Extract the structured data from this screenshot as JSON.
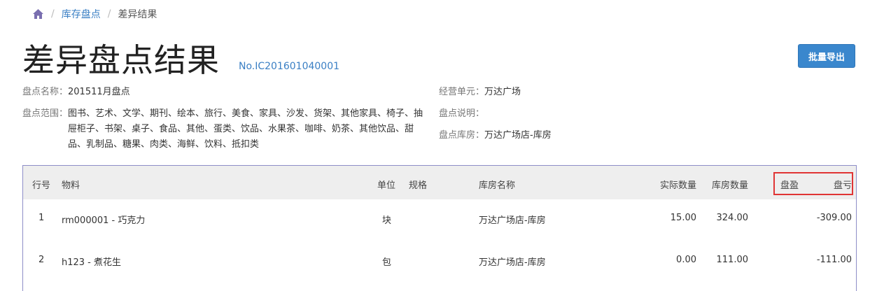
{
  "breadcrumb": {
    "home_icon": "home-icon",
    "separator": "/",
    "link": "库存盘点",
    "current": "差异结果"
  },
  "header": {
    "title": "差异盘点结果",
    "doc_no": "No.IC201601040001",
    "export_label": "批量导出"
  },
  "meta": {
    "name_label": "盘点名称：",
    "name_value": "201511月盘点",
    "range_label": "盘点范围：",
    "range_value": "图书、艺术、文学、期刊、绘本、旅行、美食、家具、沙发、货架、其他家具、椅子、抽屉柜子、书架、桌子、食品、其他、蛋类、饮品、水果茶、咖啡、奶茶、其他饮品、甜品、乳制品、糖果、肉类、海鲜、饮料、抵扣类",
    "unit_label": "经营单元：",
    "unit_value": "万达广场",
    "desc_label": "盘点说明：",
    "desc_value": "",
    "warehouse_label": "盘点库房：",
    "warehouse_value": "万达广场店-库房"
  },
  "table": {
    "headers": {
      "row_no": "行号",
      "material": "物料",
      "unit": "单位",
      "spec": "规格",
      "warehouse": "库房名称",
      "actual_qty": "实际数量",
      "stock_qty": "库房数量",
      "surplus": "盘盈",
      "loss": "盘亏"
    },
    "rows": [
      {
        "row_no": "1",
        "material": "rm000001 - 巧克力",
        "unit": "块",
        "spec": "",
        "warehouse": "万达广场店-库房",
        "actual_qty": "15.00",
        "stock_qty": "324.00",
        "surplus": "",
        "loss": "-309.00"
      },
      {
        "row_no": "2",
        "material": "h123 - 煮花生",
        "unit": "包",
        "spec": "",
        "warehouse": "万达广场店-库房",
        "actual_qty": "0.00",
        "stock_qty": "111.00",
        "surplus": "",
        "loss": "-111.00"
      }
    ]
  },
  "colors": {
    "link": "#3a7fc4",
    "button": "#3a87cd",
    "highlight": "#e03535",
    "table_border": "#8e8ec8",
    "header_bg": "#eeeeee"
  }
}
